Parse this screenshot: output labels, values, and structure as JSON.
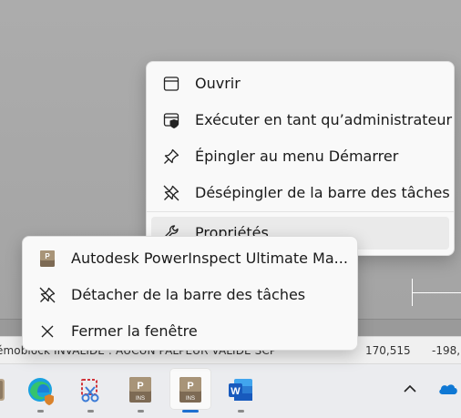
{
  "upper_menu": {
    "items": [
      {
        "label": "Ouvrir",
        "icon": "window-icon"
      },
      {
        "label": "Exécuter en tant qu’administrateur",
        "icon": "admin-shield-icon"
      },
      {
        "label": "Épingler au menu Démarrer",
        "icon": "pin-icon"
      },
      {
        "label": "Désépingler de la barre des tâches",
        "icon": "unpin-icon"
      },
      {
        "label": "Propriétés",
        "icon": "wrench-icon"
      }
    ]
  },
  "lower_menu": {
    "items": [
      {
        "label": "Autodesk PowerInspect Ultimate Ma...",
        "icon": "powerinspect-app-icon"
      },
      {
        "label": "Détacher de la barre des tâches",
        "icon": "unpin-icon"
      },
      {
        "label": "Fermer la fenêtre",
        "icon": "close-icon"
      }
    ]
  },
  "status_bar": {
    "left_text": "émoblock  INVALIDE : AUCUN PALPEUR VALIDE  SCP",
    "x_value": "170,515",
    "y_value": "-198,"
  },
  "taskbar": {
    "apps": [
      {
        "name": "app-partial",
        "icon": "app-icon"
      },
      {
        "name": "edge",
        "icon": "edge-icon"
      },
      {
        "name": "snipping-tool",
        "icon": "snipping-tool-icon"
      },
      {
        "name": "powerinspect-1",
        "icon": "powerinspect-icon",
        "badge": "INS"
      },
      {
        "name": "powerinspect-2",
        "icon": "powerinspect-icon",
        "badge": "INS"
      },
      {
        "name": "word",
        "icon": "word-icon"
      }
    ],
    "tray": [
      {
        "name": "show-hidden-icons",
        "icon": "chevron-up-icon"
      },
      {
        "name": "onedrive",
        "icon": "cloud-icon"
      }
    ]
  },
  "colors": {
    "accent": "#1c6fd0",
    "menu_bg": "#f9f9f9",
    "hover_bg": "#eaeaea",
    "word_blue": "#185abd",
    "onedrive_blue": "#0f78d4"
  }
}
